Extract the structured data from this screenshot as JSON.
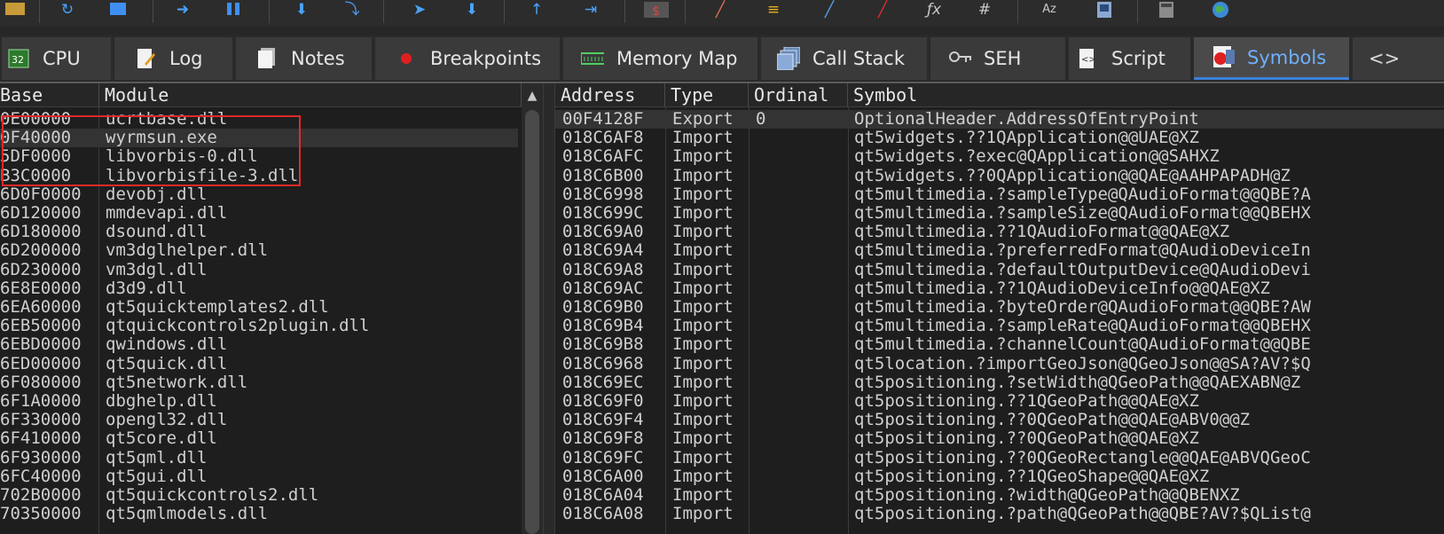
{
  "toolbar": {
    "icons": [
      "save-icon",
      "restart-icon",
      "stop-icon",
      "run-icon",
      "pause-icon",
      "step-into-icon",
      "step-over-icon",
      "execute-till-return-icon",
      "run-to-user-code-icon",
      "trace-into-icon",
      "trace-over-icon",
      "script-icon",
      "patch-icon",
      "comment-icon",
      "label-icon",
      "bookmark-icon",
      "function-icon",
      "hash-icon",
      "font-icon",
      "calculator-icon",
      "notepad-icon",
      "globe-icon"
    ],
    "func_glyph": "ƒx",
    "hash_glyph": "#",
    "font_glyph": "Az"
  },
  "tabs": [
    {
      "label": "CPU",
      "icon": "cpu-icon",
      "active": false
    },
    {
      "label": "Log",
      "icon": "log-icon",
      "active": false
    },
    {
      "label": "Notes",
      "icon": "notes-icon",
      "active": false
    },
    {
      "label": "Breakpoints",
      "icon": "breakpoint-icon",
      "active": false
    },
    {
      "label": "Memory Map",
      "icon": "memory-map-icon",
      "active": false
    },
    {
      "label": "Call Stack",
      "icon": "call-stack-icon",
      "active": false
    },
    {
      "label": "SEH",
      "icon": "seh-icon",
      "active": false
    },
    {
      "label": "Script",
      "icon": "script-tab-icon",
      "active": false
    },
    {
      "label": "Symbols",
      "icon": "symbols-icon",
      "active": true
    }
  ],
  "modules": {
    "headers": [
      "Base",
      "Module"
    ],
    "rows": [
      {
        "base": "0E00000",
        "module": "ucrtbase.dll"
      },
      {
        "base": "0F40000",
        "module": "wyrmsun.exe"
      },
      {
        "base": "5DF0000",
        "module": "libvorbis-0.dll"
      },
      {
        "base": "B3C0000",
        "module": "libvorbisfile-3.dll"
      },
      {
        "base": "6D0F0000",
        "module": "devobj.dll"
      },
      {
        "base": "6D120000",
        "module": "mmdevapi.dll"
      },
      {
        "base": "6D180000",
        "module": "dsound.dll"
      },
      {
        "base": "6D200000",
        "module": "vm3dglhelper.dll"
      },
      {
        "base": "6D230000",
        "module": "vm3dgl.dll"
      },
      {
        "base": "6E8E0000",
        "module": "d3d9.dll"
      },
      {
        "base": "6EA60000",
        "module": "qt5quicktemplates2.dll"
      },
      {
        "base": "6EB50000",
        "module": "qtquickcontrols2plugin.dll"
      },
      {
        "base": "6EBD0000",
        "module": "qwindows.dll"
      },
      {
        "base": "6ED00000",
        "module": "qt5quick.dll"
      },
      {
        "base": "6F080000",
        "module": "qt5network.dll"
      },
      {
        "base": "6F1A0000",
        "module": "dbghelp.dll"
      },
      {
        "base": "6F330000",
        "module": "opengl32.dll"
      },
      {
        "base": "6F410000",
        "module": "qt5core.dll"
      },
      {
        "base": "6F930000",
        "module": "qt5qml.dll"
      },
      {
        "base": "6FC40000",
        "module": "qt5gui.dll"
      },
      {
        "base": "702B0000",
        "module": "qt5quickcontrols2.dll"
      },
      {
        "base": "70350000",
        "module": "qt5qmlmodels.dll"
      }
    ]
  },
  "symbols": {
    "headers": [
      "Address",
      "Type",
      "Ordinal",
      "Symbol"
    ],
    "rows": [
      {
        "address": "00F4128F",
        "type": "Export",
        "ordinal": "0",
        "symbol": "OptionalHeader.AddressOfEntryPoint"
      },
      {
        "address": "018C6AF8",
        "type": "Import",
        "ordinal": "",
        "symbol": "qt5widgets.??1QApplication@@UAE@XZ"
      },
      {
        "address": "018C6AFC",
        "type": "Import",
        "ordinal": "",
        "symbol": "qt5widgets.?exec@QApplication@@SAHXZ"
      },
      {
        "address": "018C6B00",
        "type": "Import",
        "ordinal": "",
        "symbol": "qt5widgets.??0QApplication@@QAE@AAHPAPADH@Z"
      },
      {
        "address": "018C6998",
        "type": "Import",
        "ordinal": "",
        "symbol": "qt5multimedia.?sampleType@QAudioFormat@@QBE?A"
      },
      {
        "address": "018C699C",
        "type": "Import",
        "ordinal": "",
        "symbol": "qt5multimedia.?sampleSize@QAudioFormat@@QBEHX"
      },
      {
        "address": "018C69A0",
        "type": "Import",
        "ordinal": "",
        "symbol": "qt5multimedia.??1QAudioFormat@@QAE@XZ"
      },
      {
        "address": "018C69A4",
        "type": "Import",
        "ordinal": "",
        "symbol": "qt5multimedia.?preferredFormat@QAudioDeviceIn"
      },
      {
        "address": "018C69A8",
        "type": "Import",
        "ordinal": "",
        "symbol": "qt5multimedia.?defaultOutputDevice@QAudioDevi"
      },
      {
        "address": "018C69AC",
        "type": "Import",
        "ordinal": "",
        "symbol": "qt5multimedia.??1QAudioDeviceInfo@@QAE@XZ"
      },
      {
        "address": "018C69B0",
        "type": "Import",
        "ordinal": "",
        "symbol": "qt5multimedia.?byteOrder@QAudioFormat@@QBE?AW"
      },
      {
        "address": "018C69B4",
        "type": "Import",
        "ordinal": "",
        "symbol": "qt5multimedia.?sampleRate@QAudioFormat@@QBEHX"
      },
      {
        "address": "018C69B8",
        "type": "Import",
        "ordinal": "",
        "symbol": "qt5multimedia.?channelCount@QAudioFormat@@QBE"
      },
      {
        "address": "018C6968",
        "type": "Import",
        "ordinal": "",
        "symbol": "qt5location.?importGeoJson@QGeoJson@@SA?AV?$Q"
      },
      {
        "address": "018C69EC",
        "type": "Import",
        "ordinal": "",
        "symbol": "qt5positioning.?setWidth@QGeoPath@@QAEXABN@Z"
      },
      {
        "address": "018C69F0",
        "type": "Import",
        "ordinal": "",
        "symbol": "qt5positioning.??1QGeoPath@@QAE@XZ"
      },
      {
        "address": "018C69F4",
        "type": "Import",
        "ordinal": "",
        "symbol": "qt5positioning.??0QGeoPath@@QAE@ABV0@@Z"
      },
      {
        "address": "018C69F8",
        "type": "Import",
        "ordinal": "",
        "symbol": "qt5positioning.??0QGeoPath@@QAE@XZ"
      },
      {
        "address": "018C69FC",
        "type": "Import",
        "ordinal": "",
        "symbol": "qt5positioning.??0QGeoRectangle@@QAE@ABVQGeoC"
      },
      {
        "address": "018C6A00",
        "type": "Import",
        "ordinal": "",
        "symbol": "qt5positioning.??1QGeoShape@@QAE@XZ"
      },
      {
        "address": "018C6A04",
        "type": "Import",
        "ordinal": "",
        "symbol": "qt5positioning.?width@QGeoPath@@QBENXZ"
      },
      {
        "address": "018C6A08",
        "type": "Import",
        "ordinal": "",
        "symbol": "qt5positioning.?path@QGeoPath@@QBE?AV?$QList@"
      }
    ]
  },
  "colors": {
    "accent": "#3c7fd8",
    "highlight_box": "#e02a2a",
    "active_tab_text": "#6fb0ff"
  }
}
